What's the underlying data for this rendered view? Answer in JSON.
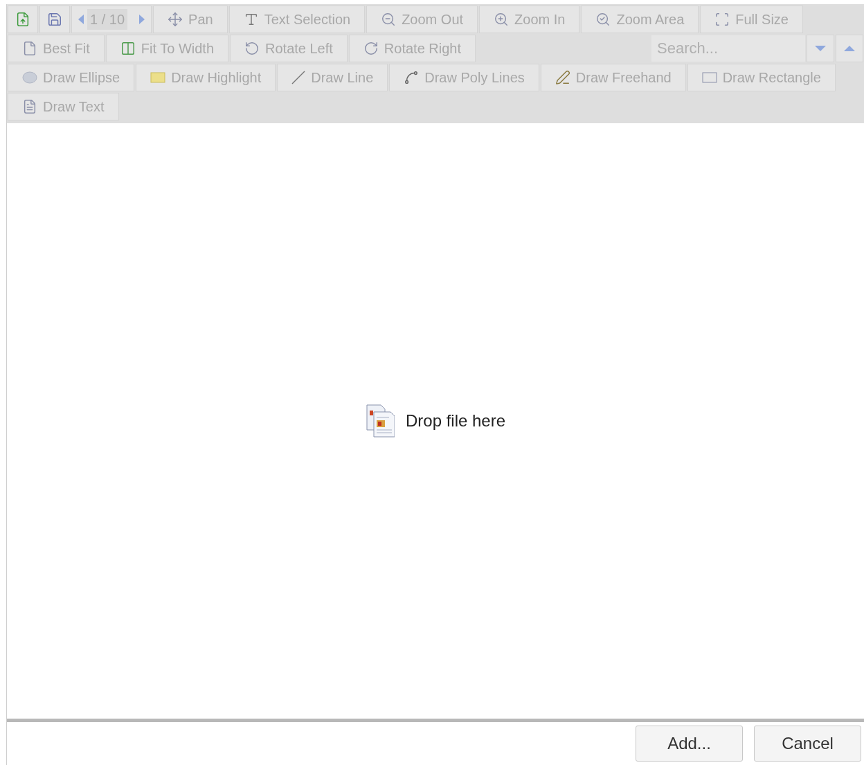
{
  "toolbar": {
    "disabled": true,
    "rows": [
      {
        "items": [
          {
            "kind": "icon"
          },
          {
            "kind": "icon"
          },
          {
            "kind": "pager",
            "label": "1 / 10"
          },
          {
            "kind": "tool",
            "label": "Pan"
          },
          {
            "kind": "tool",
            "label": "Text Selection"
          },
          {
            "kind": "tool",
            "label": "Zoom Out"
          },
          {
            "kind": "tool",
            "label": "Zoom In"
          },
          {
            "kind": "tool",
            "label": "Zoom Area"
          },
          {
            "kind": "tool",
            "label": "Full Size"
          }
        ]
      },
      {
        "items": [
          {
            "kind": "tool",
            "label": "Best Fit"
          },
          {
            "kind": "tool",
            "label": "Fit To Width"
          },
          {
            "kind": "tool",
            "label": "Rotate Left"
          },
          {
            "kind": "tool",
            "label": "Rotate Right"
          },
          {
            "kind": "search",
            "placeholder": "Search..."
          },
          {
            "kind": "down"
          },
          {
            "kind": "up"
          }
        ]
      },
      {
        "items": [
          {
            "kind": "tool",
            "label": "Draw Ellipse"
          },
          {
            "kind": "tool",
            "label": "Draw Highlight"
          },
          {
            "kind": "tool",
            "label": "Draw Line"
          },
          {
            "kind": "tool",
            "label": "Draw Poly Lines"
          },
          {
            "kind": "tool",
            "label": "Draw Freehand"
          },
          {
            "kind": "tool",
            "label": "Draw Rectangle"
          }
        ]
      },
      {
        "items": [
          {
            "kind": "tool",
            "label": "Draw Text"
          }
        ]
      }
    ]
  },
  "drop_zone": {
    "label": "Drop file here"
  },
  "buttons": [
    "Add...",
    "Cancel"
  ]
}
